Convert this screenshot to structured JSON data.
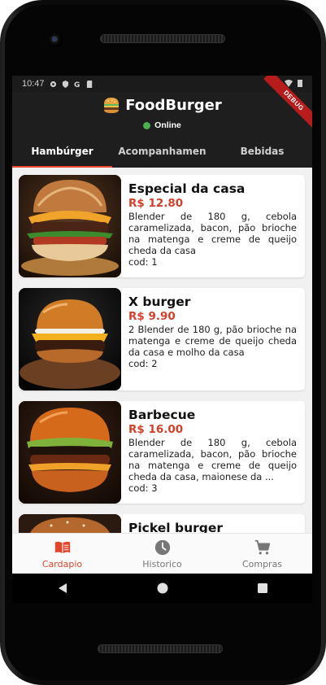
{
  "status_bar": {
    "time": "10:47"
  },
  "app": {
    "title": "FoodBurger",
    "connection_status": "Online",
    "debug_label": "DEBUG"
  },
  "tabs": [
    {
      "label": "Hambúrger",
      "active": true
    },
    {
      "label": "Acompanhamen",
      "active": false
    },
    {
      "label": "Bebidas",
      "active": false
    }
  ],
  "products": [
    {
      "name": "Especial da casa",
      "price": "R$ 12.80",
      "description": "Blender de 180 g, cebola caramelizada, bacon, pão brioche na matenga e creme de queijo cheda da casa",
      "code": "cod: 1"
    },
    {
      "name": "X burger",
      "price": "R$ 9.90",
      "description": "2 Blender de 180 g, pão brioche na matenga e creme de queijo cheda da casa e molho da casa",
      "code": "cod: 2"
    },
    {
      "name": "Barbecue",
      "price": "R$ 16.00",
      "description": "Blender de 180 g, cebola caramelizada, bacon, pão brioche na matenga e creme de queijo cheda da casa, maionese da ...",
      "code": "cod: 3"
    },
    {
      "name": "Pickel burger",
      "price": "",
      "description": "",
      "code": ""
    }
  ],
  "bottom_nav": [
    {
      "label": "Cardapio",
      "icon": "menu-book-icon",
      "active": true
    },
    {
      "label": "Historico",
      "icon": "history-clock-icon",
      "active": false
    },
    {
      "label": "Compras",
      "icon": "shopping-cart-icon",
      "active": false
    }
  ],
  "colors": {
    "accent": "#e0462e",
    "price": "#d2412a",
    "online": "#4caf50",
    "app_bar": "#1e1e1e"
  }
}
